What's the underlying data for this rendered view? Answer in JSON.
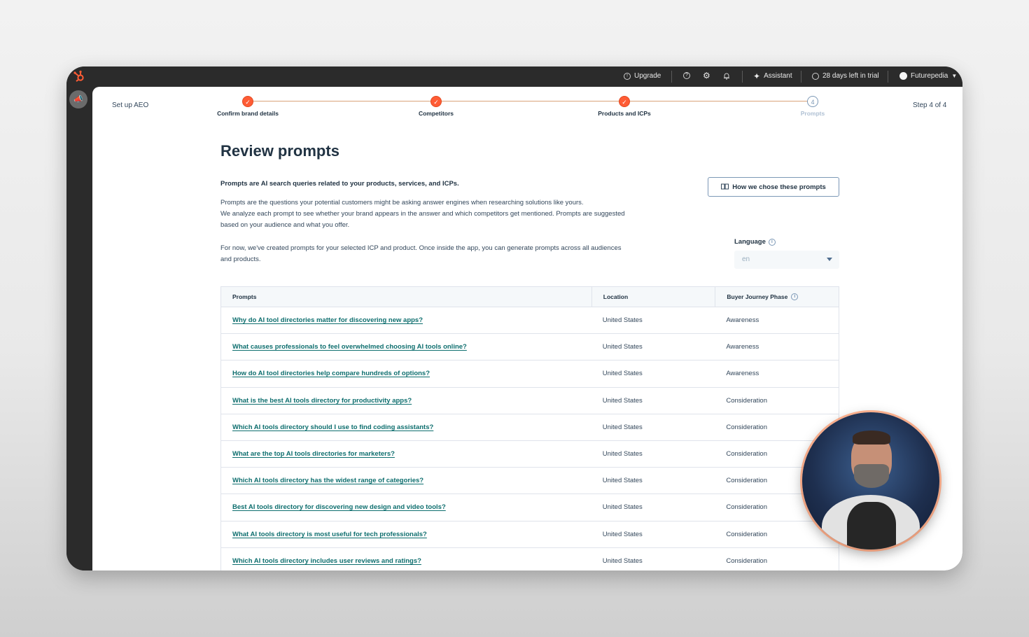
{
  "topbar": {
    "upgrade": "Upgrade",
    "assistant": "Assistant",
    "trial": "28 days left in trial",
    "account": "Futurepedia"
  },
  "header": {
    "setup_label": "Set up AEO",
    "step_counter": "Step 4 of 4"
  },
  "stepper": {
    "steps": [
      {
        "label": "Confirm brand details",
        "status": "complete"
      },
      {
        "label": "Competitors",
        "status": "complete"
      },
      {
        "label": "Products and ICPs",
        "status": "complete"
      },
      {
        "label": "Prompts",
        "status": "current"
      }
    ]
  },
  "page": {
    "title": "Review prompts",
    "intro": "Prompts are AI search queries related to your products, services, and ICPs.",
    "para1_line1": "Prompts are the questions your potential customers might be asking answer engines when researching solutions like yours.",
    "para1_line2": "We analyze each prompt to see whether your brand appears in the answer and which competitors get mentioned. Prompts are suggested",
    "para1_line3": "based on your audience and what you offer.",
    "para2_line1": "For now, we've created prompts for your selected ICP and product. Once inside the app, you can generate prompts across all audiences",
    "para2_line2": "and products.",
    "how_button": "How we chose these prompts",
    "language_label": "Language",
    "language_value": "en"
  },
  "table": {
    "headers": [
      "Prompts",
      "Location",
      "Buyer Journey Phase"
    ],
    "rows": [
      {
        "prompt": "Why do AI tool directories matter for discovering new apps?",
        "location": "United States",
        "phase": "Awareness"
      },
      {
        "prompt": "What causes professionals to feel overwhelmed choosing AI tools online?",
        "location": "United States",
        "phase": "Awareness"
      },
      {
        "prompt": "How do AI tool directories help compare hundreds of options?",
        "location": "United States",
        "phase": "Awareness"
      },
      {
        "prompt": "What is the best AI tools directory for productivity apps?",
        "location": "United States",
        "phase": "Consideration"
      },
      {
        "prompt": "Which AI tools directory should I use to find coding assistants?",
        "location": "United States",
        "phase": "Consideration"
      },
      {
        "prompt": "What are the top AI tools directories for marketers?",
        "location": "United States",
        "phase": "Consideration"
      },
      {
        "prompt": "Which AI tools directory has the widest range of categories?",
        "location": "United States",
        "phase": "Consideration"
      },
      {
        "prompt": "Best AI tools directory for discovering new design and video tools?",
        "location": "United States",
        "phase": "Consideration"
      },
      {
        "prompt": "What AI tools directory is most useful for tech professionals?",
        "location": "United States",
        "phase": "Consideration"
      },
      {
        "prompt": "Which AI tools directory includes user reviews and ratings?",
        "location": "United States",
        "phase": "Consideration"
      }
    ]
  },
  "colors": {
    "accent": "#ff5c35",
    "link": "#0d6e6e",
    "topbar": "#2b2b2b"
  }
}
